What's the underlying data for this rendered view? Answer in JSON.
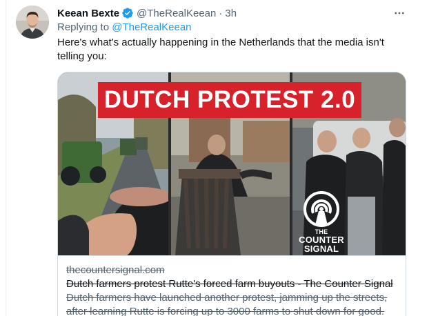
{
  "tweet": {
    "display_name": "Keean Bexte",
    "verified_icon": "verified-badge-icon",
    "handle": "@TheRealKeean",
    "separator": "·",
    "time": "3h",
    "reply_prefix": "Replying to",
    "reply_handle": "@TheRealKeean",
    "text": "Here's what's actually happening in the Netherlands that the media isn't telling you:"
  },
  "card": {
    "banner_text": "DUTCH PROTEST 2.0",
    "logo_line1": "THE",
    "logo_line2": "COUNTER",
    "logo_line3": "SIGNAL",
    "domain": "thecountersignal.com",
    "title": "Dutch farmers protest Rutte's forced farm buyouts - The Counter Signal",
    "description_line1": "Dutch farmers have launched another protest, jamming up the streets,",
    "description_line2": "after learning Rutte is forcing up to 3000 farms to shut down for good."
  },
  "colors": {
    "accent": "#1d9bf0",
    "banner_red": "#d7212b",
    "secondary_text": "#536471"
  }
}
